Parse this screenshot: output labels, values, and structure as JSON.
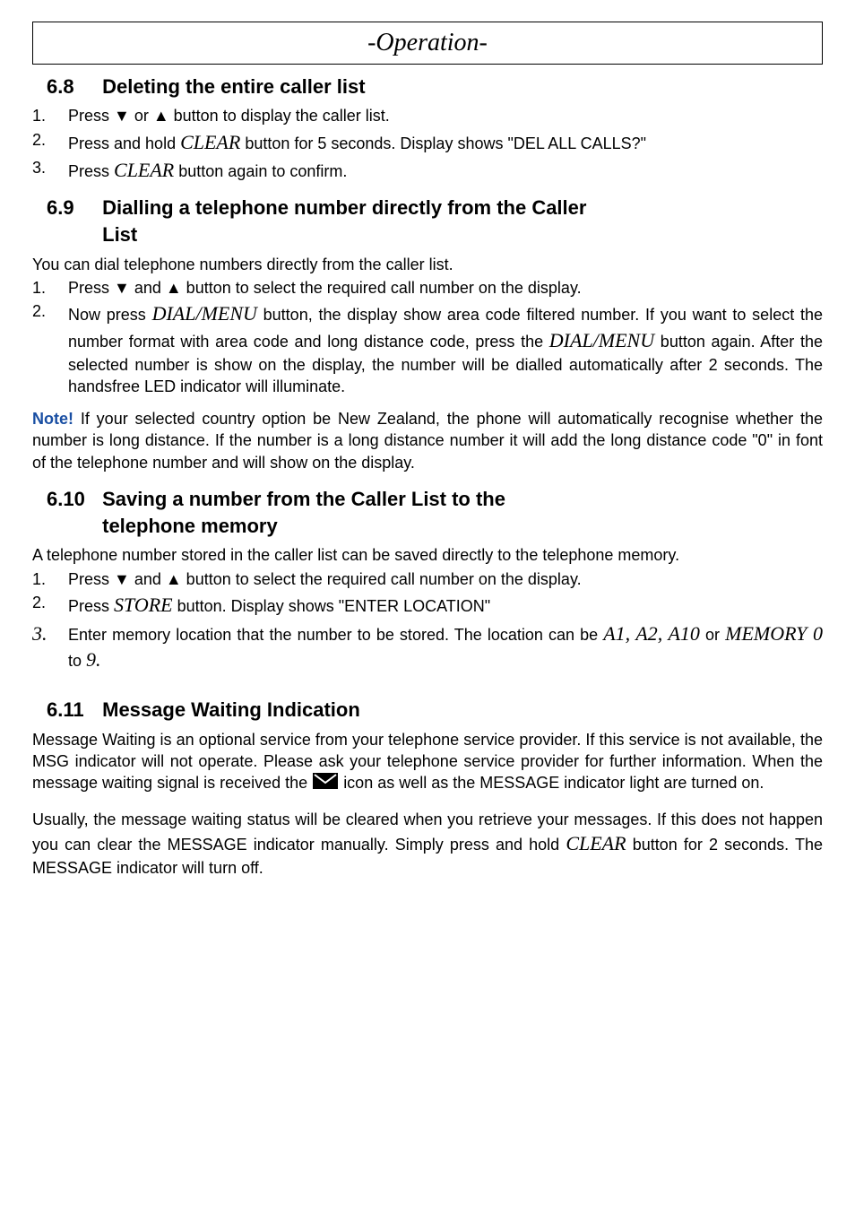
{
  "header": "-Operation-",
  "sections": {
    "s68": {
      "num": "6.8",
      "title": "Deleting the entire caller list",
      "items": [
        {
          "n": "1.",
          "pre": "Press ▼ or ▲ button to display the caller list."
        },
        {
          "n": "2.",
          "pre": "Press and hold ",
          "btn": "CLEAR",
          "post": " button for 5 seconds.   Display shows \"DEL ALL CALLS?\""
        },
        {
          "n": "3.",
          "pre": "Press ",
          "btn": "CLEAR",
          "post": " button again to confirm."
        }
      ]
    },
    "s69": {
      "num": "6.9",
      "title_l1": "Dialling a telephone number directly from the Caller",
      "title_l2": "List",
      "intro": "You can dial telephone numbers directly from the caller list.",
      "items": [
        {
          "n": "1.",
          "pre": "Press ▼ and ▲ button to select the required call number on the display."
        },
        {
          "n": "2.",
          "pre": "Now press ",
          "btn1": "DIAL/MENU",
          "mid": " button, the display show area code filtered number. If you want to select the number format with area code and long distance code, press the ",
          "btn2": "DIAL/MENU",
          "post": " button again.   After the selected number is show on the display, the number will be dialled automatically after 2 seconds. The handsfree LED indicator will illuminate."
        }
      ],
      "note_label": "Note!",
      "note_body": "   If your selected country option be New Zealand, the phone will automatically recognise whether the number is long distance.  If the number is a long distance number it will add the long distance code \"0\" in font of the telephone number and will show on the display."
    },
    "s610": {
      "num": "6.10",
      "title_l1": "Saving a number from the Caller List to the",
      "title_l2": "telephone memory",
      "intro": "A telephone number stored in the caller list can be saved directly to the telephone memory.",
      "items": [
        {
          "n": "1.",
          "pre": "Press ▼ and ▲ button to select the required call number on the display."
        },
        {
          "n": "2.",
          "pre": "Press ",
          "btn": "STORE",
          "post": " button.  Display shows \"ENTER LOCATION\""
        },
        {
          "n": "3.",
          "pre": "Enter memory location that the number to be stored.  The location can be ",
          "mem1": "A1, A2, A10",
          "or": " or ",
          "mem2": "MEMORY 0",
          "to": " to ",
          "mem3": "9."
        }
      ]
    },
    "s611": {
      "num": "6.11",
      "title": "Message Waiting Indication",
      "p1a": "Message Waiting is an optional service from your telephone service provider.  If this service is not available, the MSG indicator will not operate.  Please ask your telephone service provider for further information. When the message waiting signal is received the ",
      "p1b": " icon as well as the MESSAGE indicator light are turned on.",
      "p2a": "Usually, the message waiting status will be cleared when you retrieve your messages.   If this does not happen you can clear the MESSAGE indicator manually.  Simply press and hold ",
      "p2btn": "CLEAR",
      "p2b": " button for 2 seconds.  The MESSAGE indicator will turn off."
    }
  }
}
